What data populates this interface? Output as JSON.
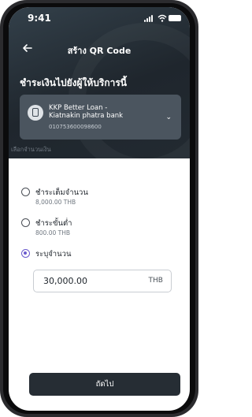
{
  "status_bar": {
    "time": "9:41"
  },
  "header": {
    "title": "สร้าง QR Code"
  },
  "section": {
    "title": "ชำระเงินไปยังผู้ให้บริการนี้"
  },
  "payee": {
    "name_line1": "KKP Better Loan -",
    "name_line2": "Kiatnakin phatra bank",
    "account": "010753600098600"
  },
  "amount_section": {
    "label": "เลือกจำนวนเงิน",
    "options": [
      {
        "title": "ชำระเต็มจำนวน",
        "subtitle": "8,000.00 THB",
        "selected": false
      },
      {
        "title": "ชำระขั้นต่ำ",
        "subtitle": "800.00 THB",
        "selected": false
      },
      {
        "title": "ระบุจำนวน",
        "selected": true
      }
    ],
    "input_value": "30,000.00",
    "currency": "THB"
  },
  "footer": {
    "next_label": "ถัดไป"
  },
  "colors": {
    "accent": "#6a5acd",
    "header_bg": "#27303a",
    "button_bg": "#262d34"
  },
  "icons": {
    "back": "arrow-left-icon",
    "payee": "bill-icon",
    "expand": "chevron-down-icon"
  }
}
